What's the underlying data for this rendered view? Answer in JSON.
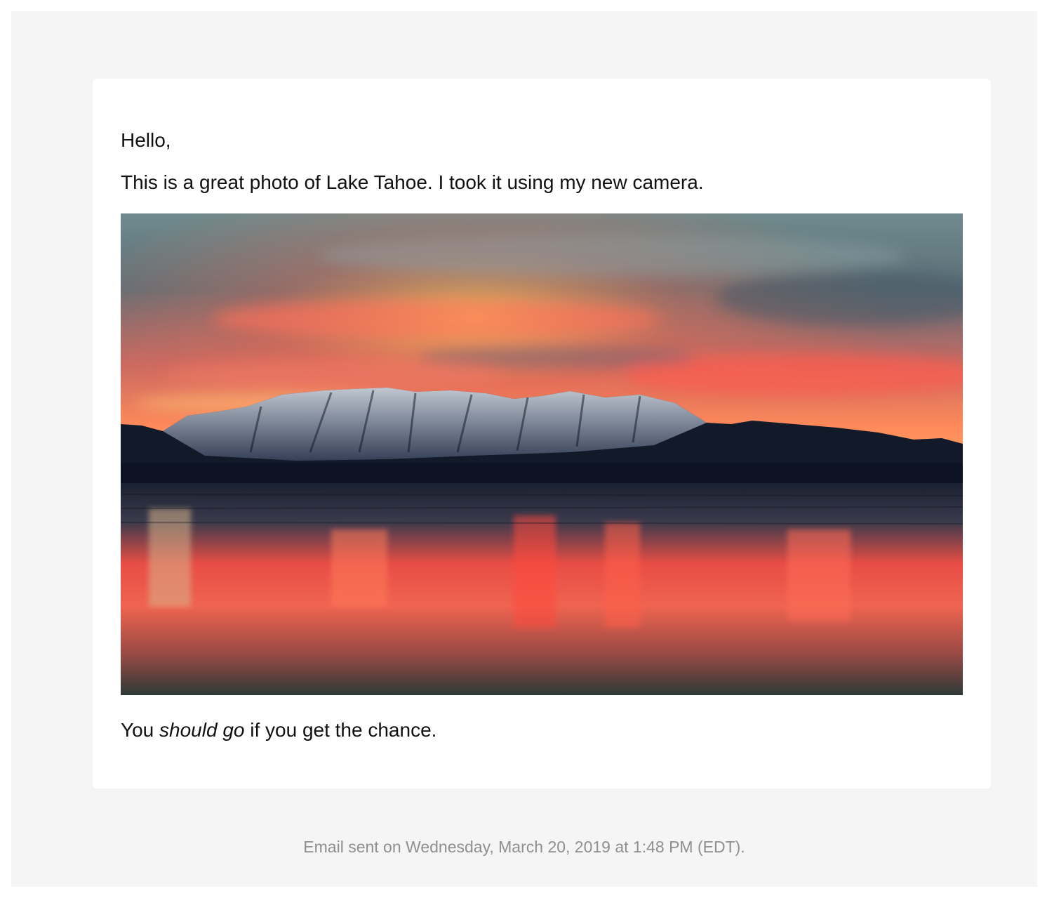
{
  "email": {
    "greeting": "Hello,",
    "intro": "This is a great photo of Lake Tahoe. I took it using my new camera.",
    "closing": {
      "before": "You ",
      "emphasis": "should go",
      "after": " if you get the chance."
    },
    "photo_alt": "Lake Tahoe"
  },
  "footer": {
    "sent_text": "Email sent on Wednesday, March 20, 2019 at 1:48 PM (EDT)."
  },
  "colors": {
    "page_background": "#ffffff",
    "outer_background": "#f5f5f5",
    "card_background": "#ffffff",
    "body_text": "#111111",
    "footer_text": "#8f8f8f"
  }
}
